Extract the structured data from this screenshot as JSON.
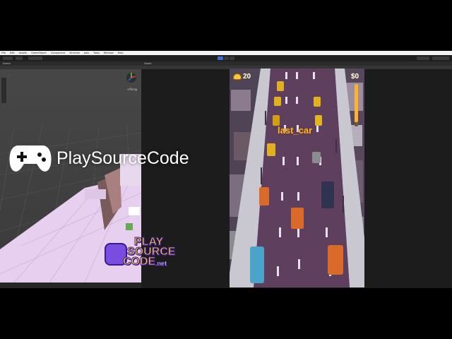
{
  "menubar": {
    "items": [
      "File",
      "Edit",
      "Assets",
      "GameObject",
      "Component",
      "Services",
      "Jobs",
      "Tools",
      "Window",
      "Help"
    ]
  },
  "panels": {
    "scene_tab": "Scene",
    "game_tab": "Game",
    "scene_gizmo_label": "<Persp"
  },
  "game": {
    "coins": "20",
    "money": "$0",
    "level_name": "last_car"
  },
  "watermark": {
    "brand": "PlaySourceCode",
    "logo_line1": "PLAY",
    "logo_line2": "SOURCE",
    "logo_line3": "CODE",
    "logo_suffix": ".net"
  },
  "colors": {
    "road": "#5e3f5e",
    "sidewalk": "#c9c7cf",
    "ground_tint": "#e7d0ef",
    "accent_orange": "#ffb22e",
    "play_button": "#3b6fcf"
  },
  "icons": [
    "gamepad-icon",
    "coin-pile-icon",
    "play-icon",
    "pause-icon",
    "step-icon",
    "scene-gizmo-icon"
  ]
}
